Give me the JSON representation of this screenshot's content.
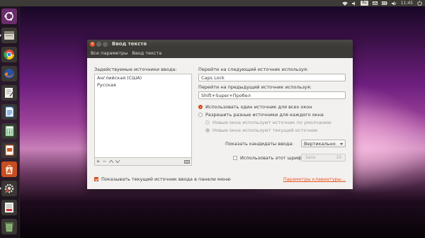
{
  "topbar": {
    "keyboard_indicator": "Ru",
    "clock": "11:45",
    "icons": [
      "network-icon",
      "sound-icon",
      "keyboard-layout-icon",
      "mail-icon",
      "battery-icon",
      "volume-icon",
      "power-icon"
    ]
  },
  "launcher": {
    "items": [
      {
        "name": "ubuntu-dash-icon"
      },
      {
        "name": "files-icon"
      },
      {
        "name": "chromium-icon"
      },
      {
        "name": "firefox-icon"
      },
      {
        "name": "text-editor-icon"
      },
      {
        "name": "writer-icon"
      },
      {
        "name": "calc-icon"
      },
      {
        "name": "impress-icon"
      },
      {
        "name": "software-center-icon"
      },
      {
        "name": "system-settings-icon"
      },
      {
        "name": "pdf-reader-icon"
      },
      {
        "name": "trash-icon"
      }
    ]
  },
  "window": {
    "title": "Ввод текста",
    "breadcrumb": [
      "Все параметры",
      "Ввод текста"
    ],
    "sources_label": "Задействуемые источники ввода:",
    "sources": [
      "Английская (США)",
      "Русская"
    ],
    "list_add": "+",
    "list_remove": "−",
    "next_label": "Перейти на следующий источник используя:",
    "next_value": "Caps Lock",
    "prev_label": "Перейти на предыдущий источник используя:",
    "prev_value": "Shift+Super+Пробел",
    "radio_same": "Использовать один источник для всех окон",
    "radio_per_window": "Разрешить разные источники для каждого окна",
    "radio_new_default": "Новые окна используют источник по умолчанию",
    "radio_new_current": "Новые окна используют текущий источник",
    "candidates_label": "Показать кандидаты ввода:",
    "candidates_value": "Вертикально",
    "font_check_label": "Использовать этот шрифт:",
    "font_name": "Sans",
    "font_size": "10",
    "show_in_panel_label": "Показывать текущий источник ввода в панели меню",
    "keyboard_settings_link": "Параметры клавиатуры..."
  },
  "colors": {
    "accent": "#e95420",
    "panel": "#3c3b37",
    "window_bg": "#f2f1f0"
  }
}
